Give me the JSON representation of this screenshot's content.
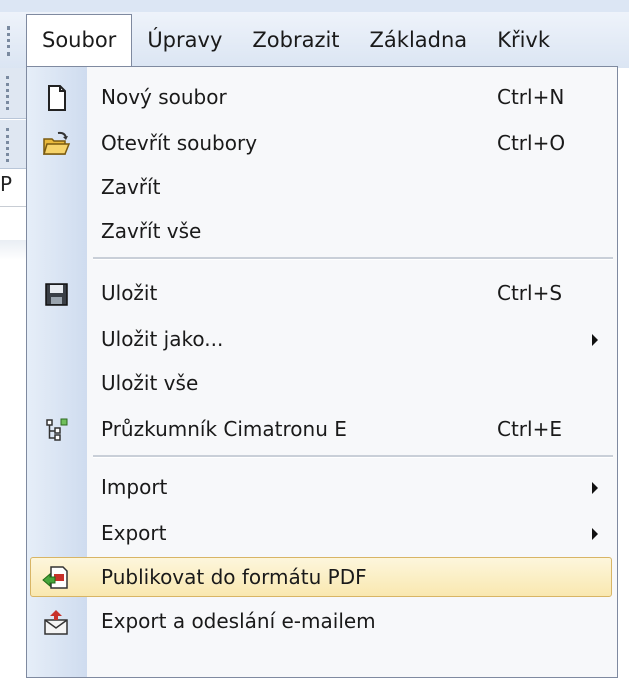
{
  "menubar": {
    "items": [
      {
        "label": "Soubor",
        "open": true
      },
      {
        "label": "Úpravy"
      },
      {
        "label": "Zobrazit"
      },
      {
        "label": "Základna"
      },
      {
        "label": "Křivk"
      }
    ]
  },
  "background": {
    "partial_letter": "P"
  },
  "file_menu": {
    "items": [
      {
        "label": "Nový soubor",
        "shortcut": "Ctrl+N",
        "icon": "new-file-icon"
      },
      {
        "label": "Otevřít soubory",
        "shortcut": "Ctrl+O",
        "icon": "open-folder-icon"
      },
      {
        "label": "Zavřít"
      },
      {
        "label": "Zavřít vše"
      },
      {
        "label": "Uložit",
        "shortcut": "Ctrl+S",
        "icon": "save-icon"
      },
      {
        "label": "Uložit jako...",
        "submenu": true
      },
      {
        "label": "Uložit vše"
      },
      {
        "label": "Průzkumník Cimatronu E",
        "shortcut": "Ctrl+E",
        "icon": "explorer-icon"
      },
      {
        "label": "Import",
        "submenu": true
      },
      {
        "label": "Export",
        "submenu": true
      },
      {
        "label": "Publikovat do formátu PDF",
        "icon": "publish-pdf-icon",
        "highlighted": true
      },
      {
        "label": "Export a odeslání e-mailem",
        "icon": "export-email-icon"
      }
    ]
  },
  "colors": {
    "highlight": "#f9e8b0",
    "highlight_border": "#d8b565",
    "gutter": "#cfdcef",
    "menubar": "#dbe5f3"
  }
}
